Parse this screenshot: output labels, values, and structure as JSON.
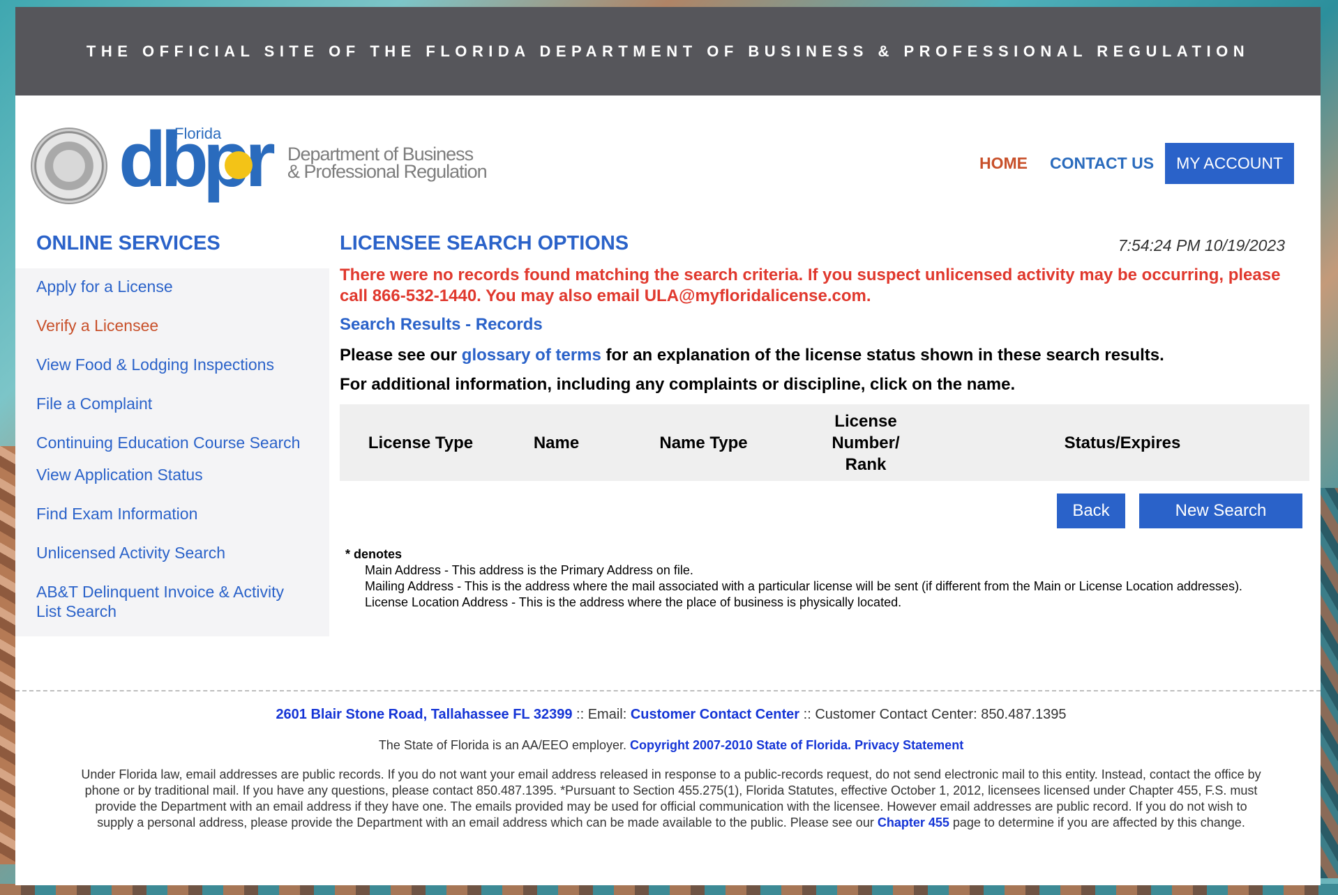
{
  "site": {
    "banner": "THE OFFICIAL SITE OF THE FLORIDA DEPARTMENT OF BUSINESS & PROFESSIONAL REGULATION",
    "logo_small": "Florida",
    "logo_big": "dbpr",
    "logo_dept_line1": "Department of Business",
    "logo_dept_line2": "& Professional Regulation"
  },
  "nav": {
    "home": "HOME",
    "contact": "CONTACT US",
    "account": "MY ACCOUNT"
  },
  "sidebar": {
    "title": "ONLINE SERVICES",
    "items": [
      {
        "label": "Apply for a License"
      },
      {
        "label": "Verify a Licensee"
      },
      {
        "label": "View Food & Lodging Inspections"
      },
      {
        "label": "File a Complaint"
      },
      {
        "label": "Continuing Education Course Search"
      },
      {
        "label": "View Application Status"
      },
      {
        "label": "Find Exam Information"
      },
      {
        "label": "Unlicensed Activity Search"
      },
      {
        "label": "AB&T Delinquent Invoice & Activity List Search"
      }
    ]
  },
  "main": {
    "title": "LICENSEE SEARCH OPTIONS",
    "timestamp": "7:54:24 PM 10/19/2023",
    "error": "There were no records found matching the search criteria. If you suspect unlicensed activity may be occurring, please call 866-532-1440. You may also email ULA@myfloridalicense.com.",
    "subhead": "Search Results - Records",
    "info_pre": "Please see our ",
    "info_link": "glossary of terms",
    "info_post": " for an explanation of the license status shown in these search results.",
    "info2": "For additional information, including any complaints or discipline, click on the name.",
    "table_headers": [
      "License Type",
      "Name",
      "Name Type",
      "License Number/ Rank",
      "Status/Expires"
    ],
    "back": "Back",
    "new_search": "New Search",
    "notes_title": "* denotes",
    "notes": [
      "Main Address - This address is the Primary Address on file.",
      "Mailing Address - This is the address where the mail associated with a particular license will be sent (if different from the Main or License Location addresses).",
      "License Location Address - This is the address where the place of business is physically located."
    ]
  },
  "footer": {
    "address": "2601 Blair Stone Road, Tallahassee FL 32399",
    "email_label": " :: Email: ",
    "email_link": "Customer Contact Center",
    "phone": " :: Customer Contact Center: 850.487.1395",
    "employer": "The State of Florida is an AA/EEO employer. ",
    "copyright": "Copyright 2007-2010 State of Florida.",
    "privacy": "Privacy Statement",
    "law_text": "Under Florida law, email addresses are public records. If you do not want your email address released in response to a public-records request, do not send electronic mail to this entity. Instead, contact the office by phone or by traditional mail. If you have any questions, please contact 850.487.1395. *Pursuant to Section 455.275(1), Florida Statutes, effective October 1, 2012, licensees licensed under Chapter 455, F.S. must provide the Department with an email address if they have one. The emails provided may be used for official communication with the licensee. However email addresses are public record. If you do not wish to supply a personal address, please provide the Department with an email address which can be made available to the public. Please see our ",
    "chapter_link": "Chapter 455",
    "law_text_end": " page to determine if you are affected by this change."
  }
}
